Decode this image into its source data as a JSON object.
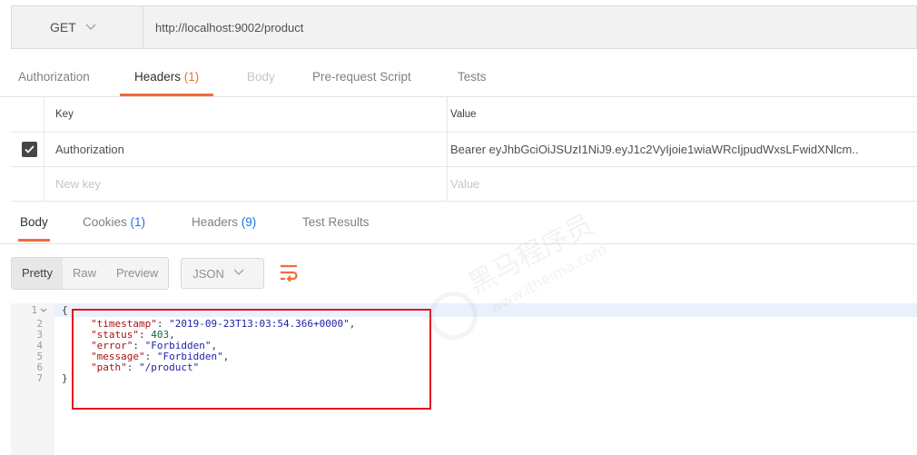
{
  "request": {
    "method": "GET",
    "url": "http://localhost:9002/product"
  },
  "request_tabs": [
    {
      "label": "Authorization"
    },
    {
      "label": "Headers",
      "count": "(1)"
    },
    {
      "label": "Body"
    },
    {
      "label": "Pre-request Script"
    },
    {
      "label": "Tests"
    }
  ],
  "headers_table": {
    "key_header": "Key",
    "value_header": "Value",
    "rows": [
      {
        "key": "Authorization",
        "value": "Bearer eyJhbGciOiJSUzI1NiJ9.eyJ1c2VyIjoie1wiaWRcIjpudWxsLFwidXNlcm.."
      }
    ],
    "new_key_placeholder": "New key",
    "new_value_placeholder": "Value"
  },
  "response_tabs": [
    {
      "label": "Body"
    },
    {
      "label": "Cookies",
      "count": "(1)"
    },
    {
      "label": "Headers",
      "count": "(9)"
    },
    {
      "label": "Test Results"
    }
  ],
  "view_modes": [
    "Pretty",
    "Raw",
    "Preview"
  ],
  "format_select": "JSON",
  "code": {
    "line_numbers": [
      "1",
      "2",
      "3",
      "4",
      "5",
      "6",
      "7"
    ],
    "open_brace": "{",
    "close_brace": "}",
    "fields": [
      {
        "key": "\"timestamp\"",
        "value": "\"2019-09-23T13:03:54.366+0000\"",
        "suffix": ","
      },
      {
        "key": "\"status\"",
        "value": "403",
        "suffix": ","
      },
      {
        "key": "\"error\"",
        "value": "\"Forbidden\"",
        "suffix": ","
      },
      {
        "key": "\"message\"",
        "value": "\"Forbidden\"",
        "suffix": ","
      },
      {
        "key": "\"path\"",
        "value": "\"/product\"",
        "suffix": ""
      }
    ]
  },
  "watermark": {
    "brand": "黑马程序员",
    "site": "www.itheima.com"
  },
  "colors": {
    "accent": "#f26b3a",
    "count_blue": "#1a73e8",
    "highlight": "#e0141e"
  },
  "icons": [
    "chevron-down-icon",
    "check-icon",
    "wrap-lines-icon",
    "fold-arrow-icon"
  ]
}
